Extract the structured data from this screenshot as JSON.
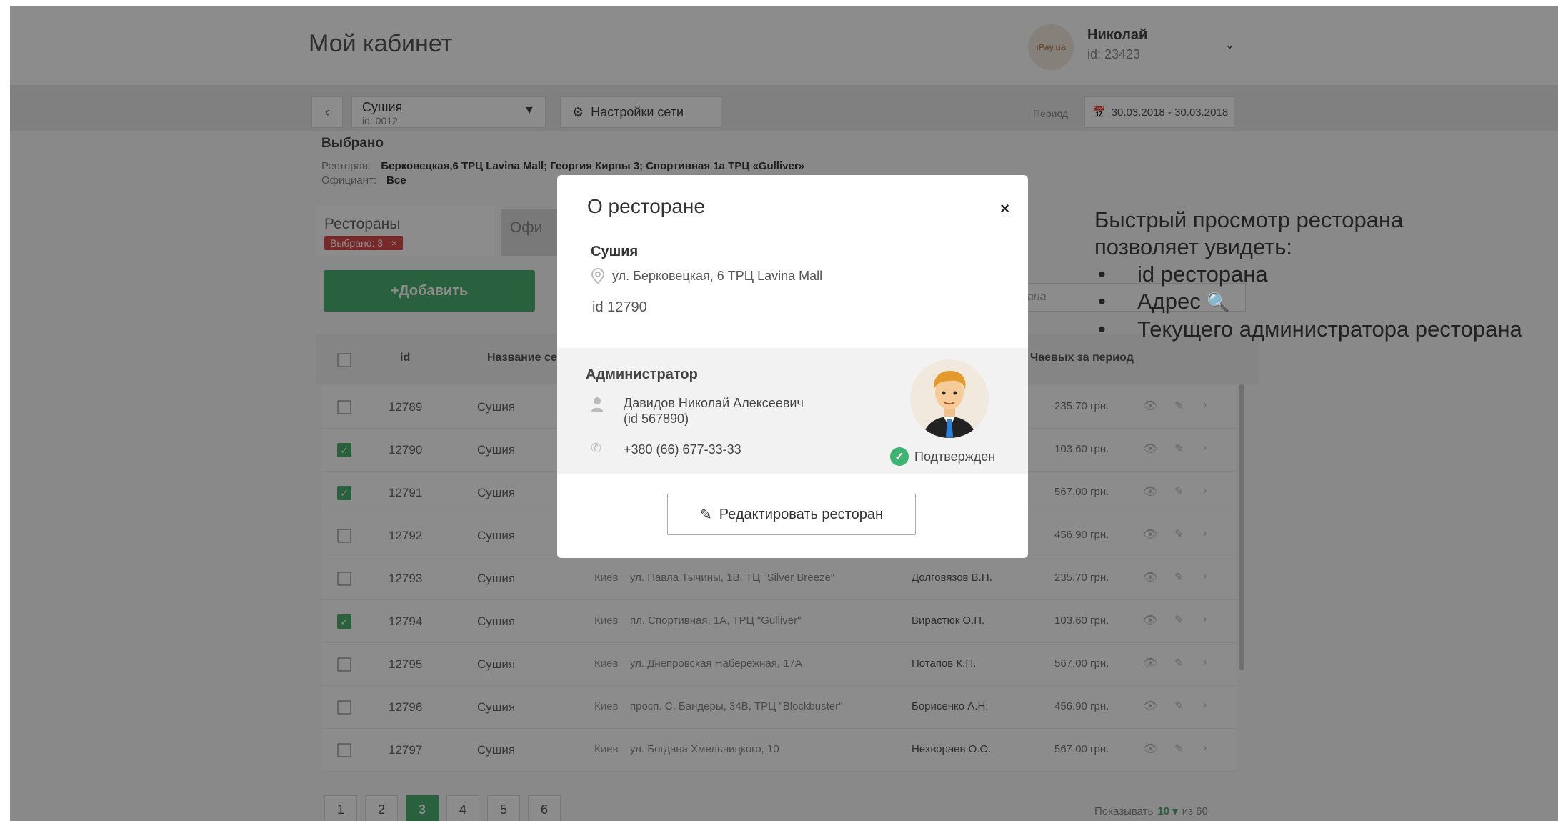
{
  "header": {
    "title": "Мой кабинет",
    "avatar_text": "iPay.ua",
    "user_name": "Николай",
    "user_id": "id: 23423"
  },
  "toolbar": {
    "network_name": "Сушия",
    "network_id": "id: 0012",
    "settings_label": "Настройки сети",
    "period_label": "Период",
    "period_value": "30.03.2018 - 30.03.2018"
  },
  "selected": {
    "title": "Выбрано",
    "restaurant_label": "Ресторан:",
    "restaurant_value": "Берковецкая,6 ТРЦ Lavina Mall; Георгия Кирпы 3; Спортивная 1а ТРЦ «Gulliver»",
    "waiter_label": "Официант:",
    "waiter_value": "Все"
  },
  "tabs": {
    "restaurants": "Рестораны",
    "badge": "Выбрано: 3",
    "badge_close": "×",
    "waiters_partial": "Офи"
  },
  "add_button": "+Добавить",
  "search_placeholder_partial": "рана",
  "table": {
    "headers": {
      "id": "id",
      "name": "Название сет",
      "tips": "Чаевых за период"
    },
    "rows": [
      {
        "id": "12789",
        "name": "Сушия",
        "city": "",
        "address": "",
        "admin": "",
        "tips": "235.70 грн.",
        "checked": false
      },
      {
        "id": "12790",
        "name": "Сушия",
        "city": "",
        "address": "",
        "admin": "",
        "tips": "103.60 грн.",
        "checked": true
      },
      {
        "id": "12791",
        "name": "Сушия",
        "city": "",
        "address": "",
        "admin": "",
        "tips": "567.00 грн.",
        "checked": true
      },
      {
        "id": "12792",
        "name": "Сушия",
        "city": "",
        "address": "",
        "admin": "",
        "tips": "456.90 грн.",
        "checked": false
      },
      {
        "id": "12793",
        "name": "Сушия",
        "city": "Киев",
        "address": "ул. Павла Тычины, 1В, ТЦ \"Silver Breeze\"",
        "admin": "Долговязов В.Н.",
        "tips": "235.70 грн.",
        "checked": false
      },
      {
        "id": "12794",
        "name": "Сушия",
        "city": "Киев",
        "address": "пл. Спортивная, 1А, ТРЦ \"Gulliver\"",
        "admin": "Вирастюк О.П.",
        "tips": "103.60 грн.",
        "checked": true
      },
      {
        "id": "12795",
        "name": "Сушия",
        "city": "Киев",
        "address": "ул. Днепровская Набережная, 17А",
        "admin": "Потапов К.П.",
        "tips": "567.00 грн.",
        "checked": false
      },
      {
        "id": "12796",
        "name": "Сушия",
        "city": "Киев",
        "address": "просп. С. Бандеры, 34В, ТРЦ \"Blockbuster\"",
        "admin": "Борисенко А.Н.",
        "tips": "456.90 грн.",
        "checked": false
      },
      {
        "id": "12797",
        "name": "Сушия",
        "city": "Киев",
        "address": "ул. Богдана Хмельницкого, 10",
        "admin": "Нехвораев О.О.",
        "tips": "567.00 грн.",
        "checked": false
      }
    ]
  },
  "pagination": {
    "pages": [
      "1",
      "2",
      "3",
      "4",
      "5",
      "6"
    ],
    "active": "3",
    "show_label": "Показывать",
    "show_value": "10 ▾",
    "total": "из 60"
  },
  "modal": {
    "title": "О ресторане",
    "close": "×",
    "restaurant_name": "Сушия",
    "address": "ул. Берковецкая, 6 ТРЦ Lavina Mall",
    "restaurant_id": "id 12790",
    "admin_title": "Администратор",
    "admin_name": "Давидов Николай Алексеевич",
    "admin_id": "(id 567890)",
    "admin_phone": "+380 (66) 677-33-33",
    "status": "Подтвержден",
    "edit_button": "Редактировать ресторан"
  },
  "note": {
    "line1": "Быстрый просмотр ресторана",
    "line2": "позволяет увидеть:",
    "items": [
      "id ресторана",
      "Адрес",
      "Текущего администратора ресторана"
    ]
  },
  "colors": {
    "accent_green": "#4caf70",
    "badge_red": "#d94c4c",
    "overlay": "rgba(0,0,0,0.45)"
  }
}
